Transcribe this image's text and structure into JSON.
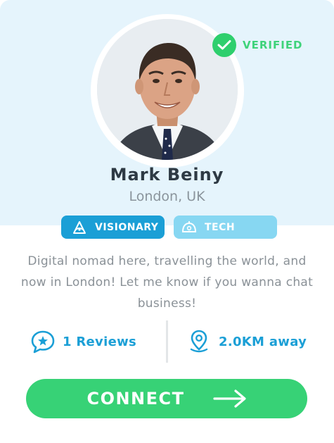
{
  "profile": {
    "name": "Mark Beiny",
    "location": "London, UK",
    "verified_label": "VERIFIED",
    "avatar_icon": "profile-photo"
  },
  "tags": [
    {
      "label": "VISIONARY",
      "icon": "visionary-icon"
    },
    {
      "label": "TECH",
      "icon": "tech-icon"
    }
  ],
  "bio": "Digital nomad here, travelling the world, and now in  London! Let me know if you wanna chat business!",
  "stats": {
    "reviews_label": "1 Reviews",
    "reviews_icon": "speech-bubble-star-icon",
    "distance_label": "2.0KM away",
    "distance_icon": "location-pin-icon"
  },
  "connect": {
    "label": "CONNECT",
    "icon": "arrow-right-icon"
  },
  "colors": {
    "header_bg": "#e5f4fc",
    "verified_green": "#2ecf6d",
    "accent_blue": "#1b9fd6",
    "tag_light_blue": "#87d7f2",
    "connect_green": "#37d276"
  }
}
